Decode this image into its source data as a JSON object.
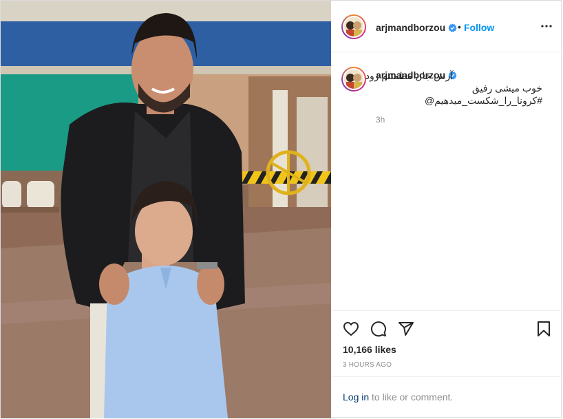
{
  "post": {
    "username": "arjmandborzou",
    "dot": "•",
    "follow_label": "Follow",
    "caption_lines": [
      "آرش جان مطمئنم زود",
      "خوب میشی رفیق",
      "#کرونا_را_شکست_میدهیم@"
    ],
    "comment_time": "3h",
    "likes": "10,166 likes",
    "posted_ago": "3 HOURS AGO",
    "login_link": "Log in",
    "login_suffix": " to like or comment."
  },
  "icons": {
    "verified": "verified-badge-icon",
    "more": "more-options-icon",
    "like": "heart-icon",
    "comment": "comment-bubble-icon",
    "share": "paper-plane-icon",
    "save": "bookmark-icon"
  },
  "colors": {
    "link": "#0095f6",
    "login": "#00376b",
    "muted": "#8e8e8e",
    "border": "#dbdbdb"
  }
}
